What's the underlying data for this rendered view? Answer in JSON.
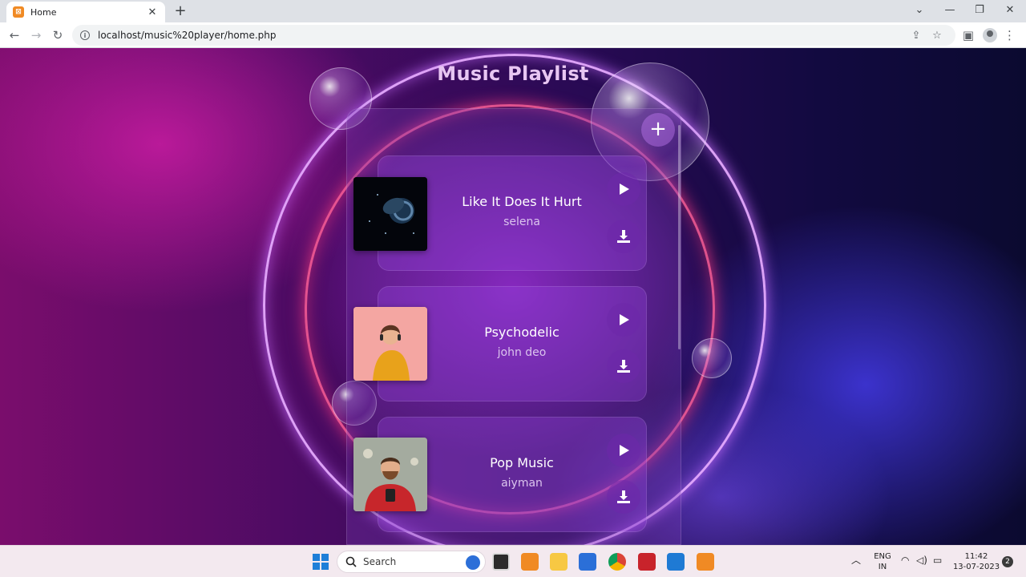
{
  "browser": {
    "tab_title": "Home",
    "tab_favicon": "xampp-icon",
    "close_tab": "✕",
    "new_tab": "+",
    "url": "localhost/music%20player/home.php",
    "window_controls": {
      "dropdown": "⌄",
      "minimize": "—",
      "maximize": "❐",
      "close": "✕"
    }
  },
  "page": {
    "title": "Music Playlist",
    "add_button": "+"
  },
  "playlist": [
    {
      "title": "Like It Does It Hurt",
      "artist": "selena"
    },
    {
      "title": "Psychodelic",
      "artist": "john deo"
    },
    {
      "title": "Pop Music",
      "artist": "aiyman"
    }
  ],
  "taskbar": {
    "search_label": "Search",
    "language": "ENG",
    "region": "IN",
    "time": "11:42",
    "date": "13-07-2023",
    "notifications": "2"
  },
  "colors": {
    "title": "#e8c6f2",
    "ring_outer": "#e6aaff",
    "ring_inner": "#ff5f96"
  }
}
